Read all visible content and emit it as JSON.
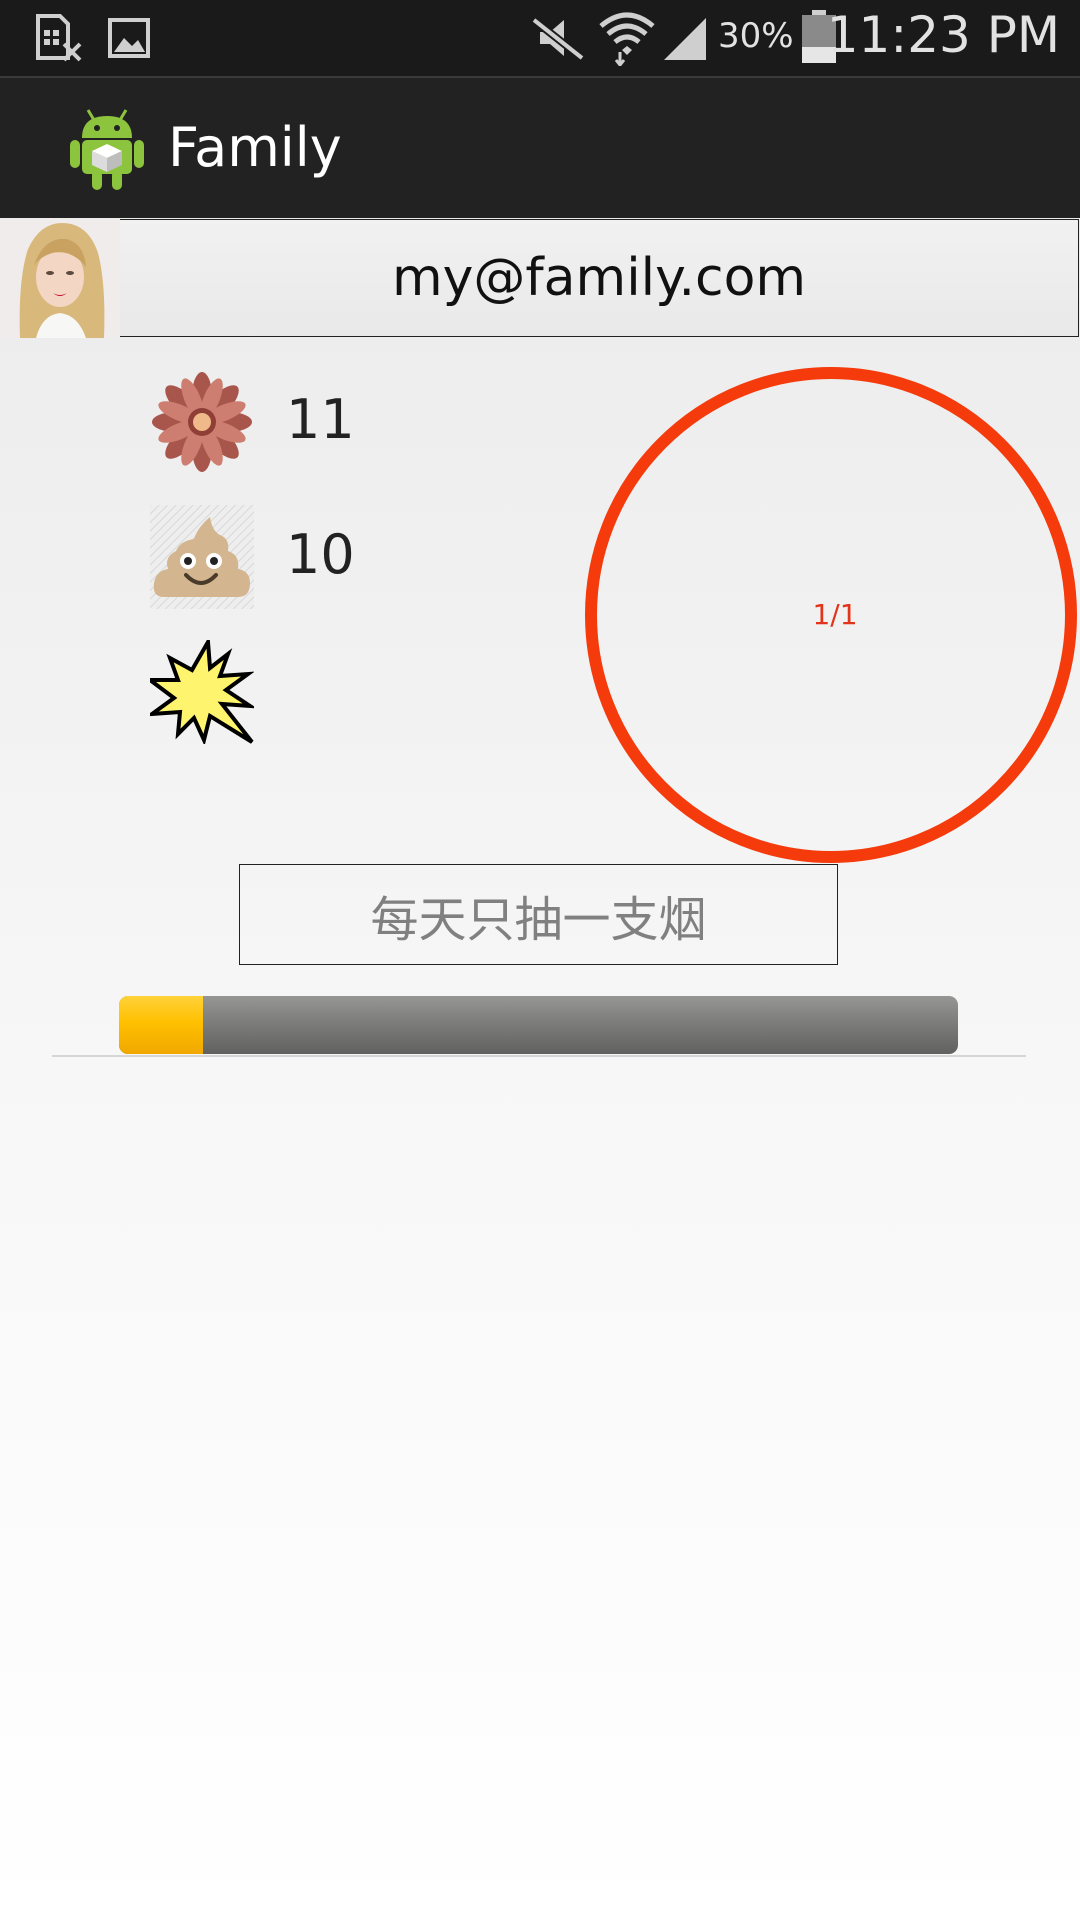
{
  "status_bar": {
    "icons": [
      "sim-card-error-icon",
      "image-notification-icon",
      "mute-icon",
      "wifi-icon",
      "signal-icon",
      "battery-icon"
    ],
    "battery_percent": "30%",
    "time": "11:23 PM"
  },
  "action_bar": {
    "app_icon": "android-icon",
    "title": "Family"
  },
  "account": {
    "avatar": "avatar",
    "email": "my@family.com"
  },
  "stats": [
    {
      "icon": "flower-icon",
      "count": "11"
    },
    {
      "icon": "poop-icon",
      "count": "10"
    },
    {
      "icon": "burst-icon",
      "count": ""
    }
  ],
  "ring": {
    "label": "1/1",
    "color": "#f53a0c"
  },
  "quote": "每天只抽一支烟",
  "progress": {
    "fraction": 0.1,
    "fill_color": "#ffc000",
    "track_color": "#7a7a78"
  }
}
